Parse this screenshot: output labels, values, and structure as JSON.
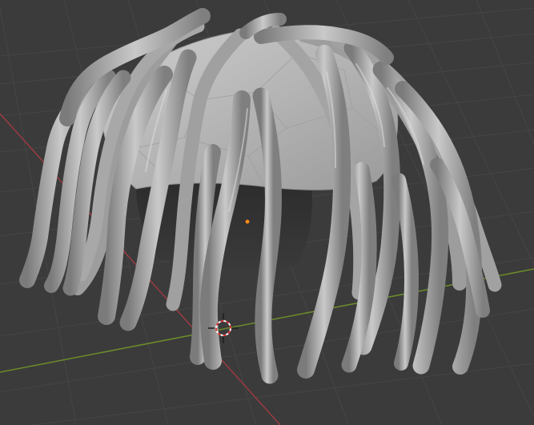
{
  "viewport": {
    "background": "#3b3b3b",
    "grid_color": "#464646",
    "x_axis_color": "#9b3a42",
    "y_axis_color": "#6b8c2a",
    "object_color": "#b8b8b8",
    "origin_dot_color": "#ff8c1a",
    "cursor_color": "#d43a3a"
  },
  "icons": {
    "cursor": "3d-cursor-icon",
    "origin": "object-origin-icon"
  }
}
